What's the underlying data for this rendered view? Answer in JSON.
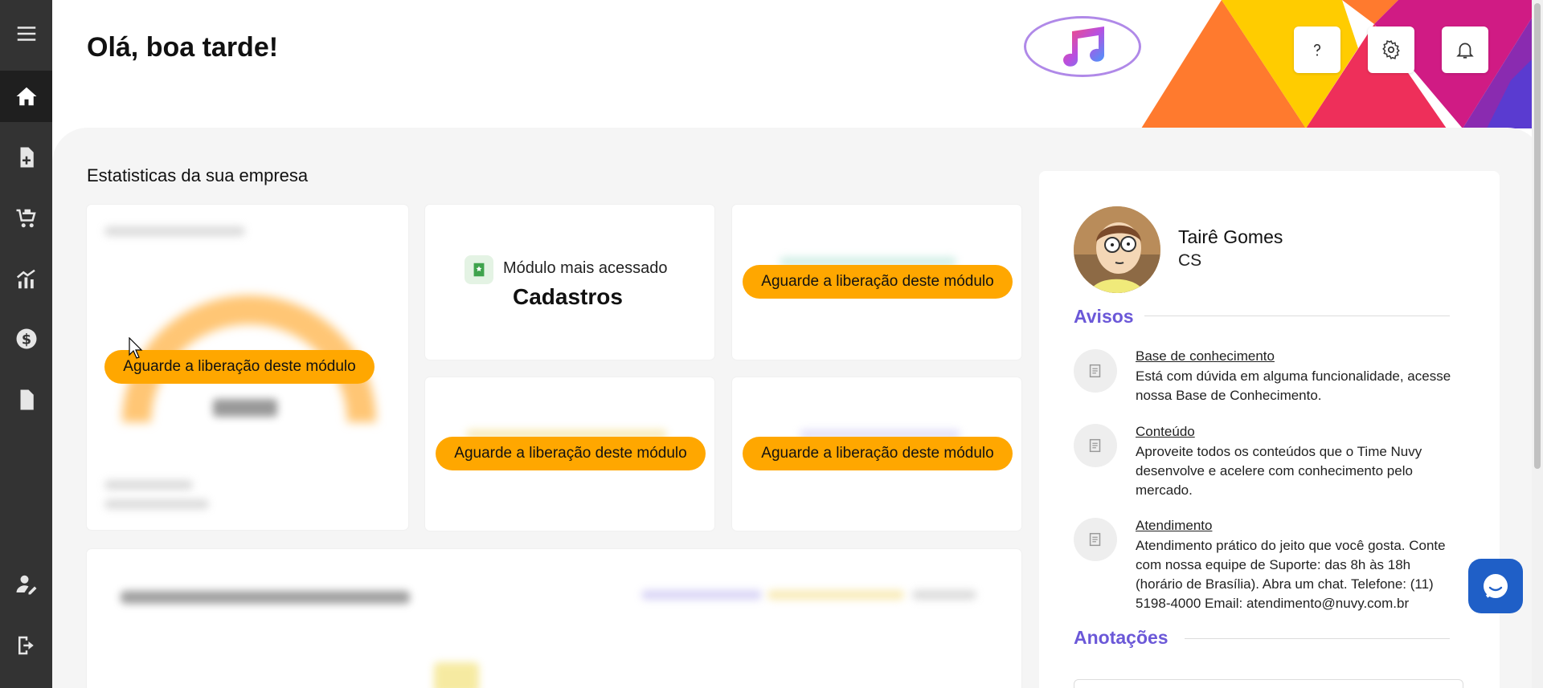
{
  "header": {
    "greeting": "Olá, boa tarde!"
  },
  "icons": {
    "menu": "hamburger-icon",
    "home": "home-icon",
    "new_document": "file-plus-icon",
    "cart": "cart-icon",
    "stats": "chart-icon",
    "finance": "dollar-icon",
    "documents": "file-icon",
    "user_edit": "user-edit-icon",
    "logout": "logout-icon",
    "help": "question-icon",
    "settings": "gear-icon",
    "notifications": "bell-icon",
    "chat": "chat-icon"
  },
  "stats": {
    "title": "Estatisticas da sua empresa",
    "locked_label": "Aguarde a liberação deste módulo",
    "most_accessed_label": "Módulo mais acessado",
    "most_accessed_value": "Cadastros"
  },
  "profile": {
    "name": "Tairê Gomes",
    "role": "CS"
  },
  "notices": {
    "title": "Avisos",
    "items": [
      {
        "title": "Base de conhecimento",
        "text": "Está com dúvida em alguma funcionalidade, acesse nossa Base de Conhecimento."
      },
      {
        "title": "Conteúdo",
        "text": "Aproveite todos os conteúdos que o Time Nuvy desenvolve e acelere com conhecimento pelo mercado."
      },
      {
        "title": "Atendimento",
        "text": "Atendimento prático do jeito que você gosta. Conte com nossa equipe de Suporte: das 8h às 18h (horário de Brasília). Abra um chat. Telefone: (11) 5198-4000 Email: atendimento@nuvy.com.br"
      }
    ]
  },
  "notes": {
    "title": "Anotações"
  },
  "colors": {
    "sidebar": "#333333",
    "accent": "#6b58d8",
    "locked_pill": "#ffa700",
    "chat": "#1f5fc7"
  }
}
